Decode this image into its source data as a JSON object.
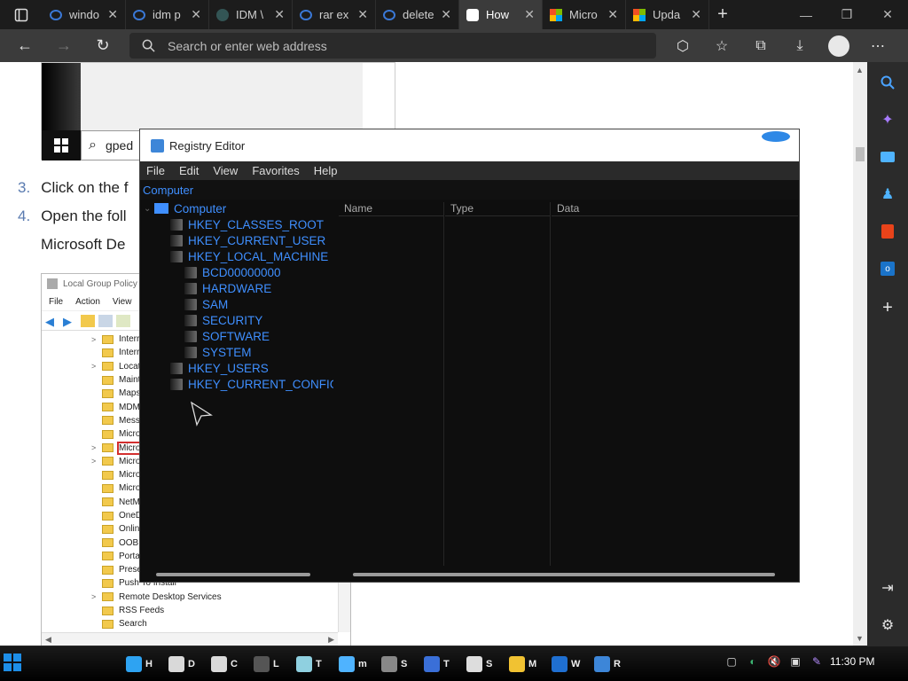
{
  "browser": {
    "tabs": [
      {
        "label": "windo",
        "favicon": "search-favicon",
        "active": false
      },
      {
        "label": "idm p",
        "favicon": "search-favicon",
        "active": false
      },
      {
        "label": "IDM \\",
        "favicon": "idm-favicon",
        "active": false
      },
      {
        "label": "rar ex",
        "favicon": "search-favicon",
        "active": false
      },
      {
        "label": "delete",
        "favicon": "search-favicon",
        "active": false
      },
      {
        "label": "How",
        "favicon": "site-favicon",
        "active": true
      },
      {
        "label": "Micro",
        "favicon": "microsoft-favicon",
        "active": false
      },
      {
        "label": "Upda",
        "favicon": "microsoft-favicon",
        "active": false
      }
    ],
    "address_placeholder": "Search or enter web address"
  },
  "page": {
    "top_image_search_text": "gped",
    "steps": [
      {
        "num": "3.",
        "text": "Click on the f"
      },
      {
        "num": "4.",
        "text": "Open the foll"
      }
    ],
    "step4_continuation": "Microsoft De",
    "group_policy": {
      "title": "Local Group Policy",
      "menu": [
        "File",
        "Action",
        "View"
      ],
      "tree_items": [
        {
          "label": "Interr",
          "expandable": true
        },
        {
          "label": "Interr",
          "expandable": false
        },
        {
          "label": "Locat",
          "expandable": true
        },
        {
          "label": "Mainte",
          "expandable": false
        },
        {
          "label": "Maps",
          "expandable": false
        },
        {
          "label": "MDM",
          "expandable": false
        },
        {
          "label": "Messa",
          "expandable": false
        },
        {
          "label": "Micro",
          "expandable": false
        },
        {
          "label": "Micro",
          "expandable": true,
          "highlighted": true
        },
        {
          "label": "Micro",
          "expandable": true
        },
        {
          "label": "Micro",
          "expandable": false
        },
        {
          "label": "Micro",
          "expandable": false
        },
        {
          "label": "NetM",
          "expandable": false
        },
        {
          "label": "OneD",
          "expandable": false
        },
        {
          "label": "Onlin",
          "expandable": false
        },
        {
          "label": "OOBE",
          "expandable": false
        },
        {
          "label": "Porta",
          "expandable": false
        },
        {
          "label": "Prese",
          "expandable": false
        },
        {
          "label": "Push To Install",
          "expandable": false
        },
        {
          "label": "Remote Desktop Services",
          "expandable": true
        },
        {
          "label": "RSS Feeds",
          "expandable": false
        },
        {
          "label": "Search",
          "expandable": false
        }
      ]
    }
  },
  "regedit": {
    "title": "Registry Editor",
    "menu": [
      "File",
      "Edit",
      "View",
      "Favorites",
      "Help"
    ],
    "path": "Computer",
    "tree": [
      {
        "label": "Computer",
        "level": 0,
        "type": "computer"
      },
      {
        "label": "HKEY_CLASSES_ROOT",
        "level": 1
      },
      {
        "label": "HKEY_CURRENT_USER",
        "level": 1
      },
      {
        "label": "HKEY_LOCAL_MACHINE",
        "level": 1
      },
      {
        "label": "BCD00000000",
        "level": 2
      },
      {
        "label": "HARDWARE",
        "level": 2
      },
      {
        "label": "SAM",
        "level": 2
      },
      {
        "label": "SECURITY",
        "level": 2
      },
      {
        "label": "SOFTWARE",
        "level": 2
      },
      {
        "label": "SYSTEM",
        "level": 2
      },
      {
        "label": "HKEY_USERS",
        "level": 1
      },
      {
        "label": "HKEY_CURRENT_CONFIG",
        "level": 1
      }
    ],
    "columns": [
      "Name",
      "Type",
      "Data"
    ]
  },
  "taskbar": {
    "apps": [
      {
        "label": "H",
        "icon": "edge-icon",
        "color": "#2ea3f2"
      },
      {
        "label": "D",
        "icon": "7zip-icon",
        "color": "#d9d9d9"
      },
      {
        "label": "C",
        "icon": "7zip-icon",
        "color": "#d9d9d9"
      },
      {
        "label": "L",
        "icon": "phone-icon",
        "color": "#555"
      },
      {
        "label": "T",
        "icon": "notepad-icon",
        "color": "#8fd0e0"
      },
      {
        "label": "m",
        "icon": "notes-icon",
        "color": "#4fb3ff"
      },
      {
        "label": "S",
        "icon": "settings-icon",
        "color": "#888"
      },
      {
        "label": "T",
        "icon": "terminal-icon",
        "color": "#3a6fd8"
      },
      {
        "label": "S",
        "icon": "document-icon",
        "color": "#ddd"
      },
      {
        "label": "M",
        "icon": "store-icon",
        "color": "#f1c232"
      },
      {
        "label": "W",
        "icon": "shield-icon",
        "color": "#1f6fd1"
      },
      {
        "label": "R",
        "icon": "regedit-icon",
        "color": "#3d86d8"
      }
    ],
    "clock": "11:30 PM"
  }
}
